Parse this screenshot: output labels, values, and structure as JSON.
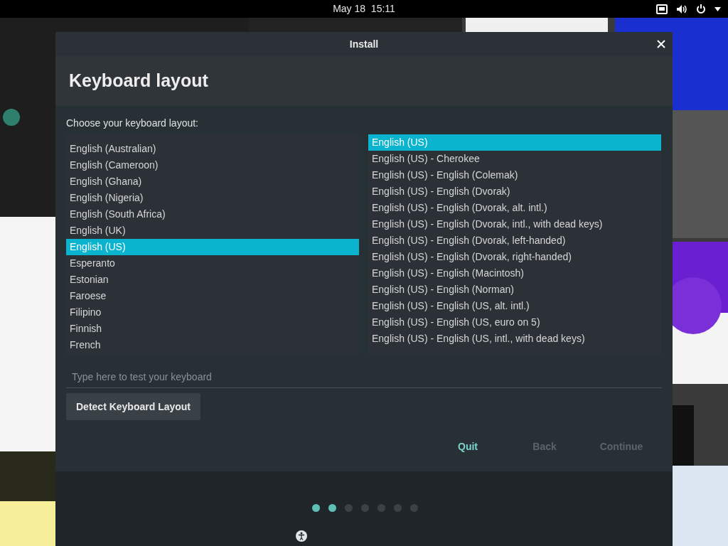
{
  "top_bar": {
    "clock": "May 18  15:11"
  },
  "window": {
    "title": "Install",
    "heading": "Keyboard layout"
  },
  "prompt": "Choose your keyboard layout:",
  "layouts": [
    {
      "label": "English (Australian)",
      "selected": false
    },
    {
      "label": "English (Cameroon)",
      "selected": false
    },
    {
      "label": "English (Ghana)",
      "selected": false
    },
    {
      "label": "English (Nigeria)",
      "selected": false
    },
    {
      "label": "English (South Africa)",
      "selected": false
    },
    {
      "label": "English (UK)",
      "selected": false
    },
    {
      "label": "English (US)",
      "selected": true
    },
    {
      "label": "Esperanto",
      "selected": false
    },
    {
      "label": "Estonian",
      "selected": false
    },
    {
      "label": "Faroese",
      "selected": false
    },
    {
      "label": "Filipino",
      "selected": false
    },
    {
      "label": "Finnish",
      "selected": false
    },
    {
      "label": "French",
      "selected": false
    }
  ],
  "variants": [
    {
      "label": "English (US)",
      "selected": true
    },
    {
      "label": "English (US) - Cherokee",
      "selected": false
    },
    {
      "label": "English (US) - English (Colemak)",
      "selected": false
    },
    {
      "label": "English (US) - English (Dvorak)",
      "selected": false
    },
    {
      "label": "English (US) - English (Dvorak, alt. intl.)",
      "selected": false
    },
    {
      "label": "English (US) - English (Dvorak, intl., with dead keys)",
      "selected": false
    },
    {
      "label": "English (US) - English (Dvorak, left-handed)",
      "selected": false
    },
    {
      "label": "English (US) - English (Dvorak, right-handed)",
      "selected": false
    },
    {
      "label": "English (US) - English (Macintosh)",
      "selected": false
    },
    {
      "label": "English (US) - English (Norman)",
      "selected": false
    },
    {
      "label": "English (US) - English (US, alt. intl.)",
      "selected": false
    },
    {
      "label": "English (US) - English (US, euro on 5)",
      "selected": false
    },
    {
      "label": "English (US) - English (US, intl., with dead keys)",
      "selected": false
    }
  ],
  "test_field": {
    "placeholder": "Type here to test your keyboard"
  },
  "detect_button": "Detect Keyboard Layout",
  "nav_buttons": [
    {
      "label": "Quit",
      "disabled": false
    },
    {
      "label": "Back",
      "disabled": true
    },
    {
      "label": "Continue",
      "disabled": true
    }
  ],
  "progress_dots": [
    {
      "done": true
    },
    {
      "done": true
    },
    {
      "done": false
    },
    {
      "done": false
    },
    {
      "done": false
    },
    {
      "done": false
    },
    {
      "done": false
    }
  ]
}
